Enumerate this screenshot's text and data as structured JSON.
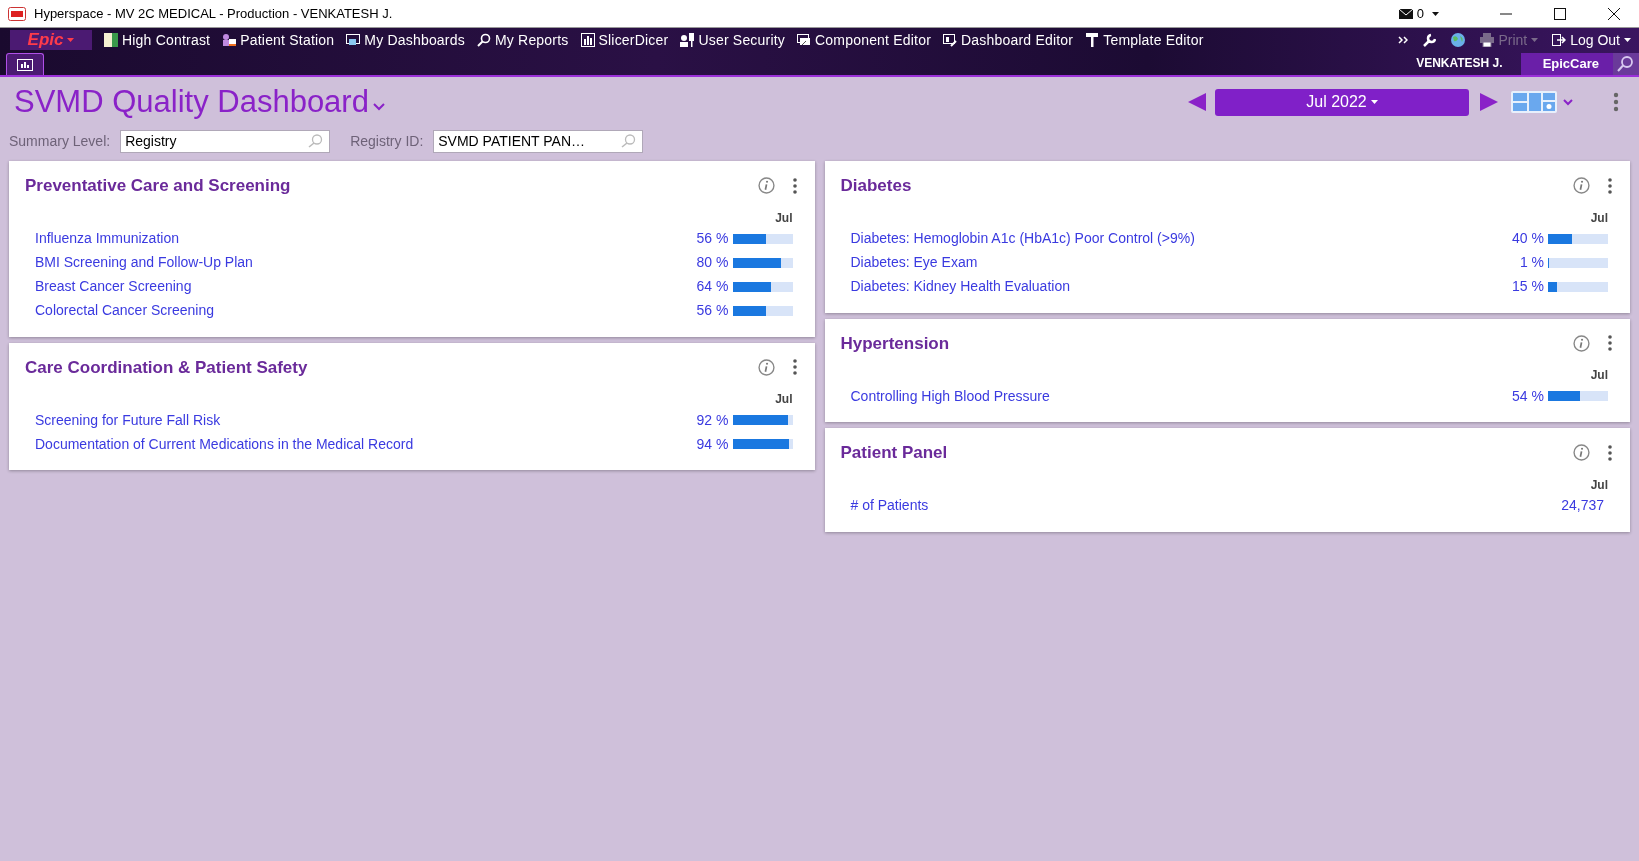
{
  "window": {
    "title": "Hyperspace - MV 2C MEDICAL - Production - VENKATESH J.",
    "mail_count": "0"
  },
  "toolbar": {
    "logo": "Epic",
    "items": [
      {
        "label": "High Contrast"
      },
      {
        "label": "Patient Station"
      },
      {
        "label": "My Dashboards"
      },
      {
        "label": "My Reports"
      },
      {
        "label": "SlicerDicer"
      },
      {
        "label": "User Security"
      },
      {
        "label": "Component Editor"
      },
      {
        "label": "Dashboard Editor"
      },
      {
        "label": "Template Editor"
      }
    ],
    "right_items": [
      {
        "label": "Print",
        "disabled": true
      },
      {
        "label": "Log Out",
        "disabled": false
      }
    ]
  },
  "tabs": [
    {
      "selected": true
    }
  ],
  "user": "VENKATESH J.",
  "app": "EpicCare",
  "dashboard": {
    "title": "SVMD Quality Dashboard",
    "period": "Jul 2022",
    "filters": [
      {
        "label": "Summary Level:",
        "value": "Registry"
      },
      {
        "label": "Registry ID:",
        "value": "SVMD PATIENT PAN…"
      }
    ]
  },
  "columns": [
    [
      {
        "title": "Preventative Care and Screening",
        "column": "Jul",
        "metrics": [
          {
            "kind": "bar",
            "name": "Influenza Immunization",
            "value": "56 %",
            "level": 0.56
          },
          {
            "kind": "bar",
            "name": "BMI Screening and Follow-Up Plan",
            "value": "80 %",
            "level": 0.8
          },
          {
            "kind": "bar",
            "name": "Breast Cancer Screening",
            "value": "64 %",
            "level": 0.64
          },
          {
            "kind": "bar",
            "name": "Colorectal Cancer Screening",
            "value": "56 %",
            "level": 0.56
          }
        ]
      },
      {
        "title": "Care Coordination & Patient Safety",
        "column": "Jul",
        "metrics": [
          {
            "kind": "bar",
            "name": "Screening for Future Fall Risk",
            "value": "92 %",
            "level": 0.92
          },
          {
            "kind": "bar",
            "name": "Documentation of Current Medications in the Medical Record",
            "value": "94 %",
            "level": 0.94
          }
        ]
      }
    ],
    [
      {
        "title": "Diabetes",
        "column": "Jul",
        "metrics": [
          {
            "kind": "bar",
            "name": "Diabetes: Hemoglobin A1c (HbA1c) Poor Control (>9%)",
            "value": "40 %",
            "level": 0.4
          },
          {
            "kind": "bar",
            "name": "Diabetes: Eye Exam",
            "value": "1 %",
            "level": 0.01
          },
          {
            "kind": "bar",
            "name": "Diabetes: Kidney Health Evaluation",
            "value": "15 %",
            "level": 0.15
          }
        ]
      },
      {
        "title": "Hypertension",
        "column": "Jul",
        "metrics": [
          {
            "kind": "bar",
            "name": "Controlling High Blood Pressure",
            "value": "54 %",
            "level": 0.54
          }
        ]
      },
      {
        "title": "Patient Panel",
        "column": "Jul",
        "metrics": [
          {
            "kind": "number",
            "name": "# of Patients",
            "value": "24,737"
          }
        ]
      }
    ]
  ]
}
